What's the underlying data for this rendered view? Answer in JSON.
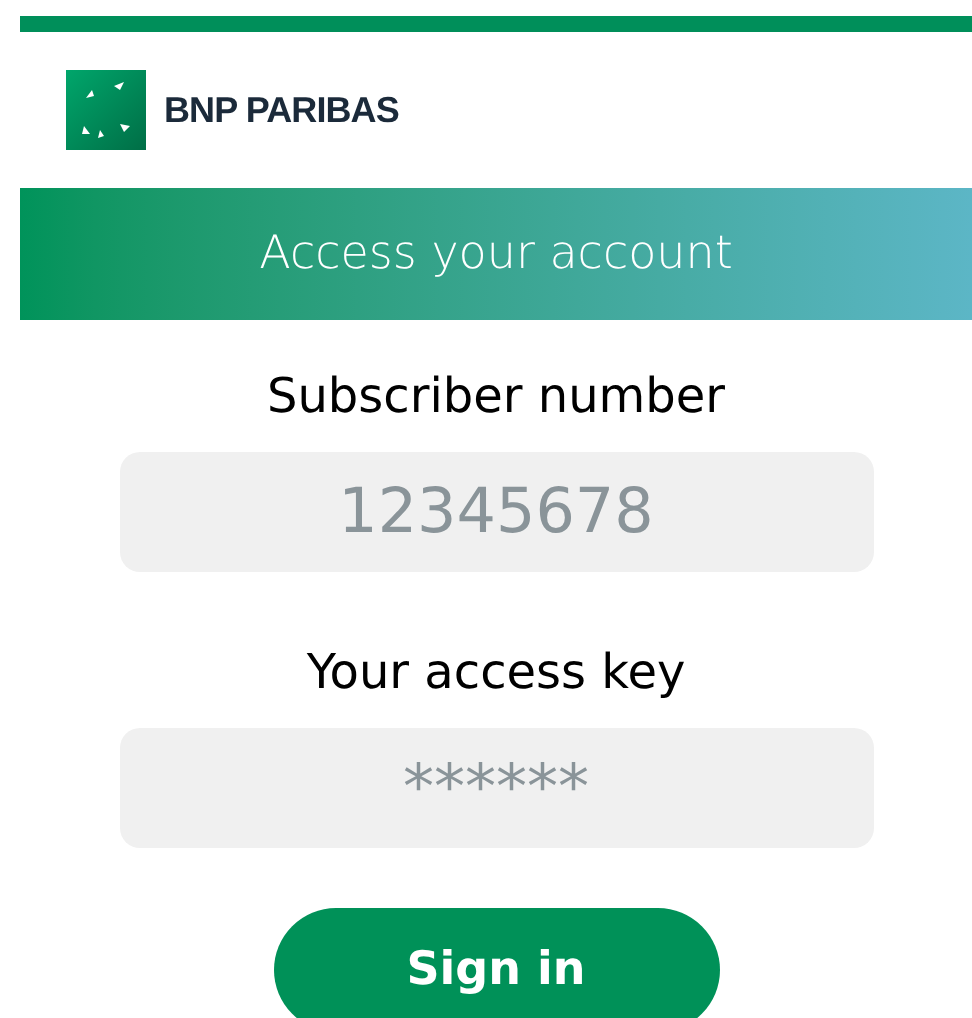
{
  "brand": {
    "name": "BNP PARIBAS"
  },
  "header": {
    "title": "Access your account"
  },
  "fields": [
    {
      "label": "Subscriber number",
      "placeholder": "12345678"
    },
    {
      "label": "Your access key",
      "placeholder": "******"
    }
  ],
  "submit": {
    "label": "Sign in"
  }
}
